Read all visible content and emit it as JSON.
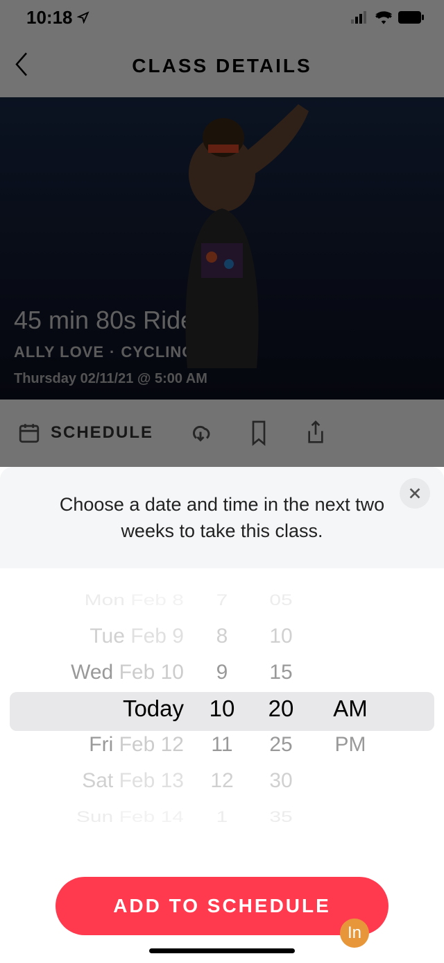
{
  "status": {
    "time": "10:18"
  },
  "nav": {
    "title": "CLASS DETAILS"
  },
  "hero": {
    "class_title": "45 min 80s Ride",
    "instructor": "ALLY LOVE",
    "category": "CYCLING",
    "datetime": "Thursday 02/11/21 @ 5:00 AM"
  },
  "actions": {
    "schedule_label": "SCHEDULE"
  },
  "sheet": {
    "prompt": "Choose a date and time in the next two weeks to take this class.",
    "cta": "ADD TO SCHEDULE"
  },
  "picker": {
    "dates": [
      {
        "day": "Mon",
        "md": "Feb 8"
      },
      {
        "day": "Tue",
        "md": "Feb 9"
      },
      {
        "day": "Wed",
        "md": "Feb 10"
      },
      {
        "day": "Today",
        "md": ""
      },
      {
        "day": "Fri",
        "md": "Feb 12"
      },
      {
        "day": "Sat",
        "md": "Feb 13"
      },
      {
        "day": "Sun",
        "md": "Feb 14"
      }
    ],
    "hours": [
      "7",
      "8",
      "9",
      "10",
      "11",
      "12",
      "1"
    ],
    "minutes": [
      "05",
      "10",
      "15",
      "20",
      "25",
      "30",
      "35"
    ],
    "ampm": [
      "AM",
      "PM"
    ]
  },
  "badge": {
    "text": "In"
  }
}
